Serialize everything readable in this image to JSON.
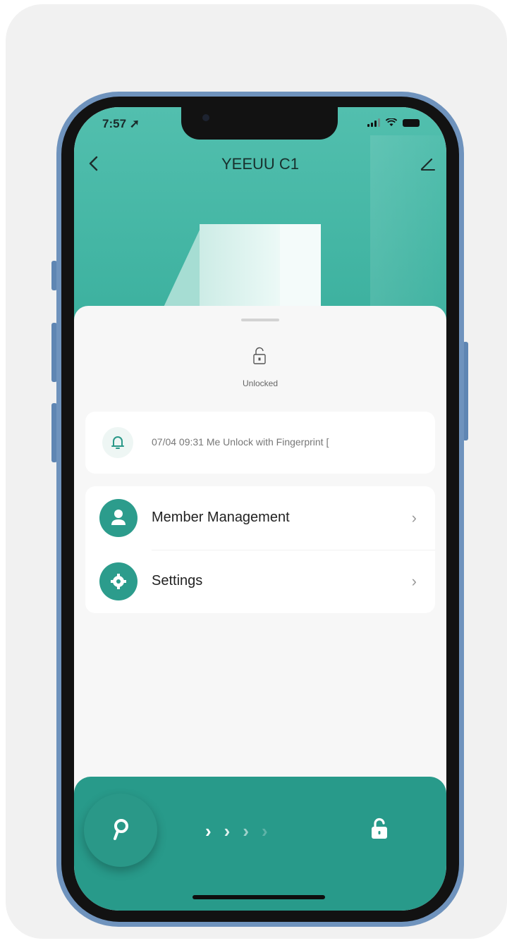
{
  "status_bar": {
    "time": "7:57 ➚"
  },
  "nav": {
    "title": "YEEUU C1",
    "back_icon": "chevron-left-icon",
    "edit_icon": "pencil-icon"
  },
  "lock_status": {
    "icon": "unlocked-padlock-icon",
    "label": "Unlocked"
  },
  "latest_log": {
    "icon": "bell-icon",
    "text": "07/04 09:31 Me  Unlock with Fingerprint  ["
  },
  "menu": {
    "items": [
      {
        "label": "Member Management",
        "icon": "person-icon"
      },
      {
        "label": "Settings",
        "icon": "gear-icon"
      }
    ]
  },
  "unlock_bar": {
    "key_icon": "key-icon",
    "arrows": [
      "›",
      "›",
      "›",
      "›"
    ],
    "target_icon": "unlocked-padlock-icon"
  },
  "colors": {
    "accent": "#2a9888",
    "hero": "#46b8a6",
    "frame": "#6f93bd"
  }
}
